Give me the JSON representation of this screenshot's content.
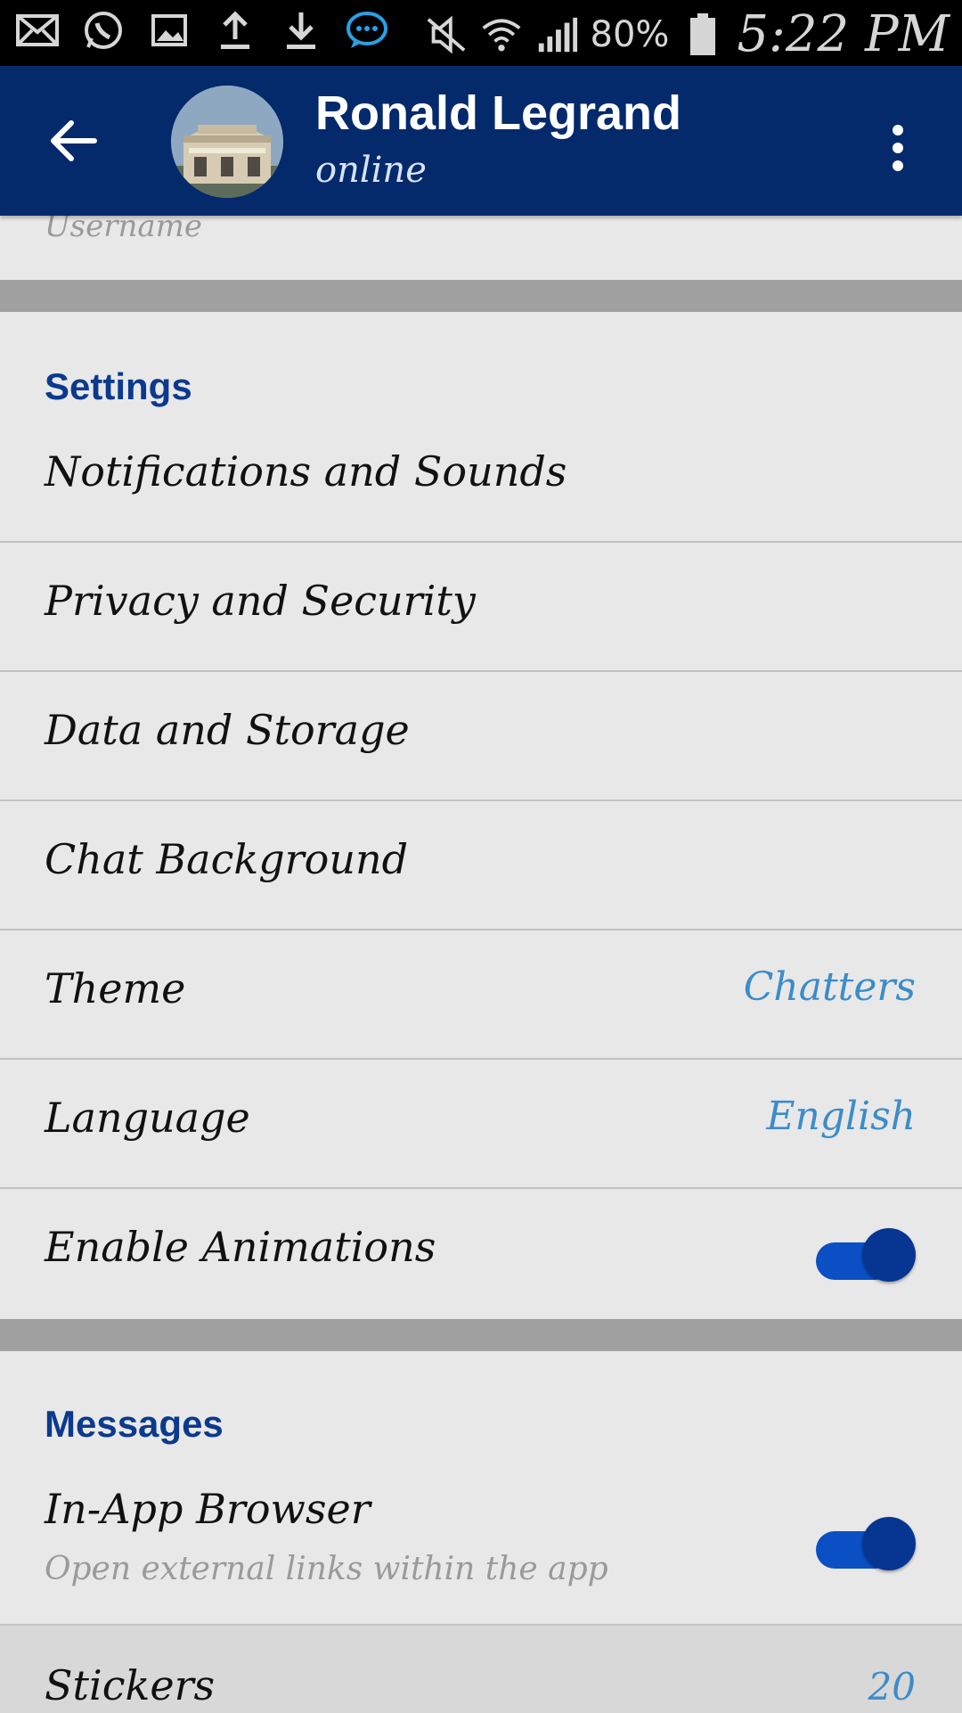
{
  "status_bar": {
    "battery": "80%",
    "time": "5:22 PM"
  },
  "header": {
    "name": "Ronald Legrand",
    "status": "online"
  },
  "partial_field": "Username",
  "settings": {
    "title": "Settings",
    "items": [
      {
        "label": "Notifications and Sounds"
      },
      {
        "label": "Privacy and Security"
      },
      {
        "label": "Data and Storage"
      },
      {
        "label": "Chat Background"
      },
      {
        "label": "Theme",
        "value": "Chatters"
      },
      {
        "label": "Language",
        "value": "English"
      },
      {
        "label": "Enable Animations",
        "toggle_on": true
      }
    ]
  },
  "messages": {
    "title": "Messages",
    "in_app_browser": {
      "label": "In-App Browser",
      "sublabel": "Open external links within the app",
      "toggle_on": true
    },
    "stickers": {
      "label": "Stickers",
      "value": "20"
    }
  },
  "colors": {
    "app_bar": "#042a6c",
    "accent_title": "#0b3a8d",
    "value_text": "#3b8cc9",
    "toggle_track": "#0a4fc4",
    "toggle_knob": "#063592"
  }
}
